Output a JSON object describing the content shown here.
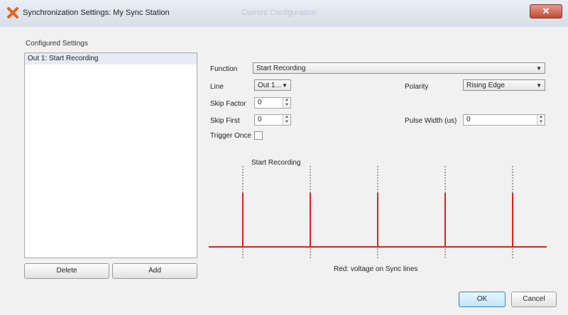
{
  "window": {
    "title": "Synchronization Settings: My Sync Station",
    "ghost_title": "Current Configuration",
    "close_glyph": "✕"
  },
  "left": {
    "section_label": "Configured Settings",
    "items": [
      "Out 1: Start Recording"
    ],
    "delete_label": "Delete",
    "add_label": "Add"
  },
  "form": {
    "function_label": "Function",
    "function_value": "Start Recording",
    "line_label": "Line",
    "line_value": "Out 1...",
    "polarity_label": "Polarity",
    "polarity_value": "Rising Edge",
    "skip_factor_label": "Skip Factor",
    "skip_factor_value": "0",
    "skip_first_label": "Skip First",
    "skip_first_value": "0",
    "pulse_width_label": "Pulse Width (us)",
    "pulse_width_value": "0",
    "trigger_once_label": "Trigger Once",
    "trigger_once_checked": false
  },
  "diagram": {
    "event_label": "Start Recording",
    "caption": "Red: voltage on Sync lines",
    "pulse_count": 5,
    "line_color": "#e0201b"
  },
  "footer": {
    "ok_label": "OK",
    "cancel_label": "Cancel"
  }
}
